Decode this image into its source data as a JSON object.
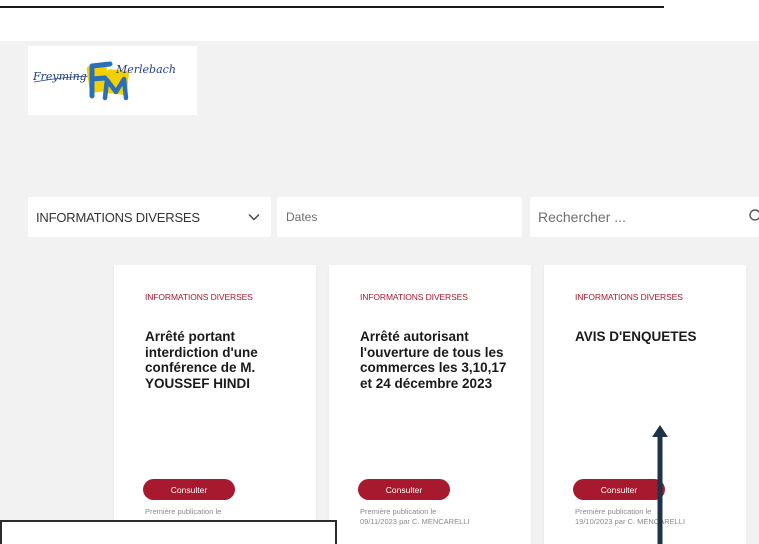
{
  "logo": {
    "text_left": "Freyming",
    "text_right": "Merlebach",
    "monogram": "FM",
    "colors": {
      "primary": "#2a6fb8",
      "accent": "#f3d100",
      "text": "#1f3f8a"
    }
  },
  "filters": {
    "category": {
      "selected": "INFORMATIONS DIVERSES",
      "icon": "chevron-down-icon"
    },
    "dates": {
      "placeholder": "Dates"
    },
    "search": {
      "placeholder": "Rechercher ...",
      "icon": "search-icon"
    }
  },
  "cards": [
    {
      "category": "INFORMATIONS DIVERSES",
      "title": "Arrêté portant interdiction d'une conférence de M. YOUSSEF HINDI",
      "button": "Consulter",
      "publication_line1": "Première publication le",
      "publication_line2": ""
    },
    {
      "category": "INFORMATIONS DIVERSES",
      "title": "Arrêté autorisant l'ouverture de tous les commerces les 3,10,17 et 24 décembre 2023",
      "button": "Consulter",
      "publication_line1": "Première publication le",
      "publication_line2": "09/11/2023 par C. MENCARELLI"
    },
    {
      "category": "INFORMATIONS DIVERSES",
      "title": "AVIS D'ENQUETES",
      "button": "Consulter",
      "publication_line1": "Première publication le",
      "publication_line2": "19/10/2023 par C. MENCARELLI"
    }
  ],
  "colors": {
    "accent": "#a6192e",
    "background": "#f2f2f2",
    "annotation": "#1f3348"
  }
}
